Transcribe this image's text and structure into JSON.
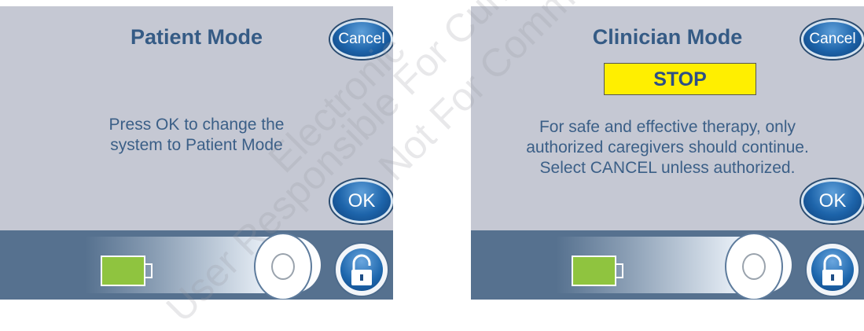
{
  "left_screen": {
    "title": "Patient Mode",
    "cancel_label": "Cancel",
    "message_line1": "Press OK to change the",
    "message_line2": "system to Patient Mode",
    "ok_label": "OK",
    "battery_level": 0.8
  },
  "right_screen": {
    "title": "Clinician Mode",
    "cancel_label": "Cancel",
    "stop_label": "STOP",
    "message_line1": "For safe and effective therapy, only",
    "message_line2": "authorized caregivers should continue.",
    "message_line3": "Select CANCEL unless authorized.",
    "ok_label": "OK",
    "battery_level": 0.8
  },
  "watermark": {
    "line1": "Electronic",
    "line2": "User Responsible For Current",
    "line3": "Not For Commercial"
  },
  "colors": {
    "panel_bg": "#c5c8d3",
    "title_text": "#355b85",
    "button_blue": "#1d64aa",
    "stop_yellow": "#ffef00",
    "bottom_bar": "#56718f",
    "battery_green": "#8fc43f"
  }
}
